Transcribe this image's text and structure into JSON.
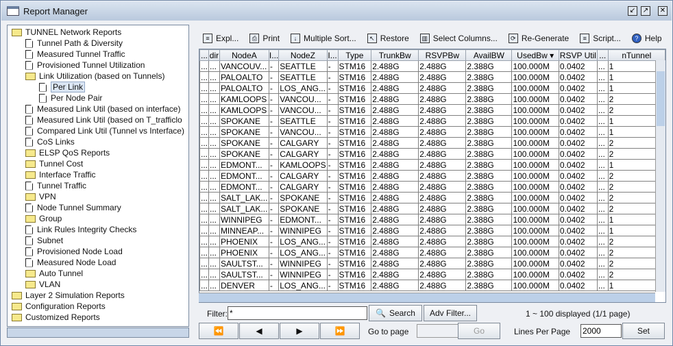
{
  "window": {
    "title": "Report Manager",
    "minimize": "↙",
    "maximize": "↗",
    "close": "✕"
  },
  "tree": [
    {
      "label": "TUNNEL Network Reports",
      "type": "folder",
      "level": 0
    },
    {
      "label": "Tunnel Path & Diversity",
      "type": "doc",
      "level": 1
    },
    {
      "label": "Measured Tunnel Traffic",
      "type": "doc",
      "level": 1
    },
    {
      "label": "Provisioned Tunnel Utilization",
      "type": "doc",
      "level": 1
    },
    {
      "label": "Link Utilization (based on Tunnels)",
      "type": "folder",
      "level": 1,
      "expander": "−"
    },
    {
      "label": "Per Link",
      "type": "doc",
      "level": 2,
      "selected": true
    },
    {
      "label": "Per Node Pair",
      "type": "doc",
      "level": 2
    },
    {
      "label": "Measured Link Util (based on interface)",
      "type": "doc",
      "level": 1
    },
    {
      "label": "Measured Link Util (based on T_trafficlo",
      "type": "doc",
      "level": 1
    },
    {
      "label": "Compared Link Util (Tunnel vs Interface)",
      "type": "doc",
      "level": 1
    },
    {
      "label": "CoS Links",
      "type": "doc",
      "level": 1
    },
    {
      "label": "ELSP QoS Reports",
      "type": "folder",
      "level": 1,
      "expander": "+"
    },
    {
      "label": "Tunnel Cost",
      "type": "folder",
      "level": 1,
      "expander": "+"
    },
    {
      "label": "Interface Traffic",
      "type": "folder",
      "level": 1,
      "expander": "+"
    },
    {
      "label": "Tunnel Traffic",
      "type": "doc",
      "level": 1
    },
    {
      "label": "VPN",
      "type": "folder",
      "level": 1,
      "expander": "+"
    },
    {
      "label": "Node Tunnel Summary",
      "type": "doc",
      "level": 1
    },
    {
      "label": "Group",
      "type": "folder",
      "level": 1,
      "expander": "+"
    },
    {
      "label": "Link Rules Integrity Checks",
      "type": "doc",
      "level": 1
    },
    {
      "label": "Subnet",
      "type": "doc",
      "level": 1
    },
    {
      "label": "Provisioned Node Load",
      "type": "doc",
      "level": 1
    },
    {
      "label": "Measured Node Load",
      "type": "doc",
      "level": 1
    },
    {
      "label": "Auto Tunnel",
      "type": "folder",
      "level": 1,
      "expander": "+"
    },
    {
      "label": "VLAN",
      "type": "folder",
      "level": 1,
      "expander": "+"
    },
    {
      "label": "Layer 2 Simulation Reports",
      "type": "folder",
      "level": 0
    },
    {
      "label": "Configuration Reports",
      "type": "folder",
      "level": 0
    },
    {
      "label": "Customized Reports",
      "type": "folder",
      "level": 0
    }
  ],
  "toolbar": [
    {
      "label": "Expl...",
      "icon": "document-icon"
    },
    {
      "label": "Print",
      "icon": "printer-icon"
    },
    {
      "label": "Multiple Sort...",
      "icon": "sort-icon"
    },
    {
      "label": "Restore",
      "icon": "restore-icon"
    },
    {
      "label": "Select Columns...",
      "icon": "columns-icon"
    },
    {
      "label": "Re-Generate",
      "icon": "refresh-icon"
    },
    {
      "label": "Script...",
      "icon": "script-icon"
    },
    {
      "label": "Help",
      "icon": "help-icon"
    }
  ],
  "columns": [
    "...",
    "dir",
    "NodeA",
    "I...",
    "NodeZ",
    "I...",
    "Type",
    "TrunkBw",
    "RSVPBw",
    "AvailBW",
    "UsedBw ▾",
    "RSVP Util",
    "...",
    "nTunnel"
  ],
  "rows": [
    [
      "VANCOUV...",
      "SEATTLE",
      "1"
    ],
    [
      "PALOALTO",
      "SEATTLE",
      "1"
    ],
    [
      "PALOALTO",
      "LOS_ANG...",
      "1"
    ],
    [
      "KAMLOOPS",
      "VANCOU...",
      "2"
    ],
    [
      "KAMLOOPS",
      "VANCOU...",
      "2"
    ],
    [
      "SPOKANE",
      "SEATTLE",
      "1"
    ],
    [
      "SPOKANE",
      "VANCOU...",
      "1"
    ],
    [
      "SPOKANE",
      "CALGARY",
      "2"
    ],
    [
      "SPOKANE",
      "CALGARY",
      "2"
    ],
    [
      "EDMONT...",
      "KAMLOOPS",
      "1"
    ],
    [
      "EDMONT...",
      "CALGARY",
      "2"
    ],
    [
      "EDMONT...",
      "CALGARY",
      "2"
    ],
    [
      "SALT_LAK...",
      "SPOKANE",
      "2"
    ],
    [
      "SALT_LAK...",
      "SPOKANE",
      "2"
    ],
    [
      "WINNIPEG",
      "EDMONT...",
      "1"
    ],
    [
      "MINNEAP...",
      "WINNIPEG",
      "1"
    ],
    [
      "PHOENIX",
      "LOS_ANG...",
      "2"
    ],
    [
      "PHOENIX",
      "LOS_ANG...",
      "2"
    ],
    [
      "SAULTST...",
      "WINNIPEG",
      "2"
    ],
    [
      "SAULTST...",
      "WINNIPEG",
      "2"
    ],
    [
      "DENVER",
      "LOS_ANG...",
      "1"
    ]
  ],
  "row_common": {
    "c0": "...",
    "dir": "...",
    "ia": "-",
    "iz": "-",
    "type": "STM16",
    "trunk": "2.488G",
    "rsvp": "2.488G",
    "avail": "2.388G",
    "used": "100.000M",
    "util": "0.0402",
    "x": "..."
  },
  "footer": {
    "filter_label": "Filter:",
    "filter_value": "*",
    "search": "Search",
    "adv_filter": "Adv Filter...",
    "status": "1 ~ 100 displayed (1/1 page)",
    "goto_label": "Go to page",
    "goto_value": "",
    "go": "Go",
    "lines_label": "Lines Per Page",
    "lines_value": "2000",
    "set": "Set",
    "first": "⏪",
    "prev": "◀",
    "next": "▶",
    "last": "⏩"
  }
}
